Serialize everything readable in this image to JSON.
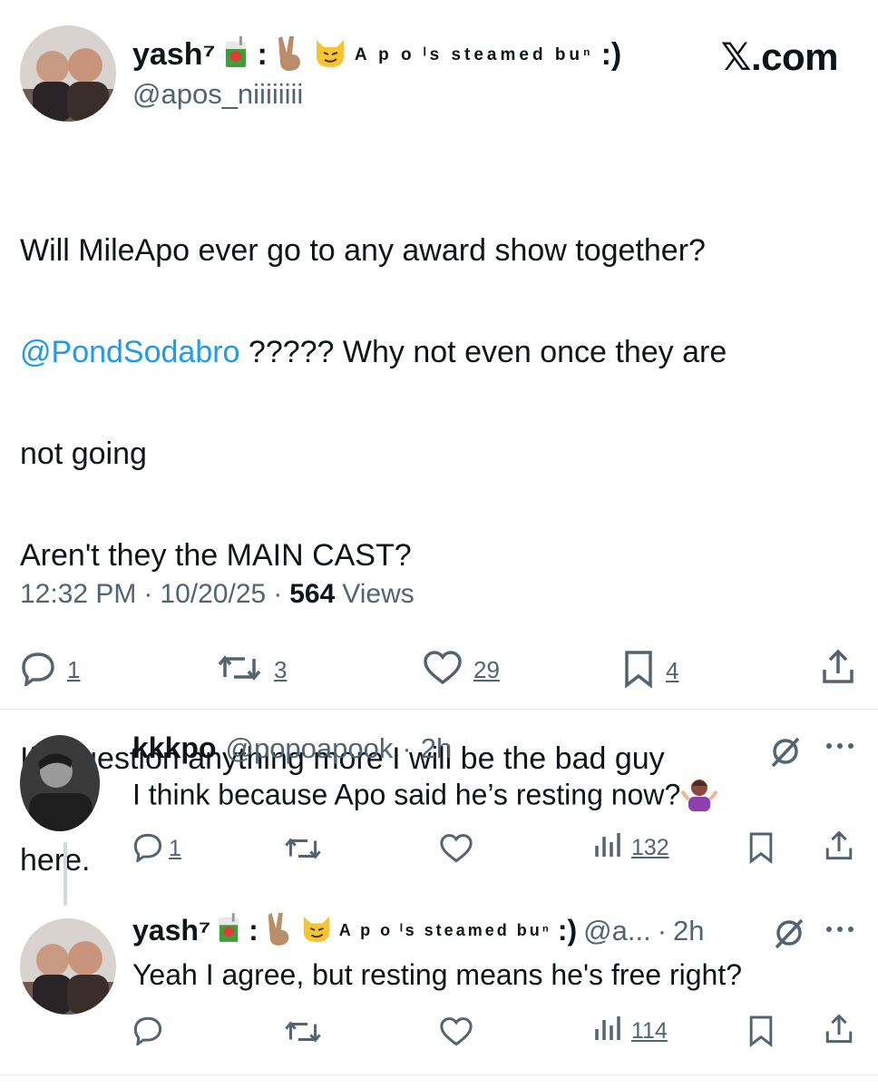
{
  "header": {
    "display_name": "yash⁷",
    "name_suffix_1": ":",
    "name_suffix_tiny": "A p o ˡs steamed buⁿ",
    "name_suffix_end": ":)",
    "handle": "@apos_niiiiiiii",
    "brand": "𝕏.com"
  },
  "tweet": {
    "line1": "Will MileApo ever go to any award show together?",
    "mention": "@PondSodabro",
    "line2_rest": " ????? Why not even once they are",
    "line3": "not going",
    "line4": "Aren't they the MAIN CAST?",
    "line5": "If I question anything more I will be the bad guy",
    "line6": "here."
  },
  "meta": {
    "time": "12:32 PM",
    "sep1": "·",
    "date": "10/20/25",
    "sep2": "·",
    "views_count": "564",
    "views_label": "Views"
  },
  "actions": {
    "replies": "1",
    "reposts": "3",
    "likes": "29",
    "bookmarks": "4"
  },
  "replies": [
    {
      "name": "kkkpo",
      "handle": "@popoapook",
      "sep": "·",
      "time": "2h",
      "text": "I think because Apo said he’s resting now?",
      "reply_count": "1",
      "views": "132"
    },
    {
      "name": "yash⁷",
      "name_suffix_1": ":",
      "name_suffix_tiny": "A p o ˡs steamed buⁿ",
      "name_suffix_end": ":)",
      "handle": "@a...",
      "sep": "·",
      "time": "2h",
      "text": "Yeah I agree, but resting means he's free right?",
      "views": "114"
    }
  ],
  "colors": {
    "mention": "#1d9bf0",
    "secondary": "#536471",
    "text": "#0f1419",
    "divider": "#e6e9eb"
  }
}
